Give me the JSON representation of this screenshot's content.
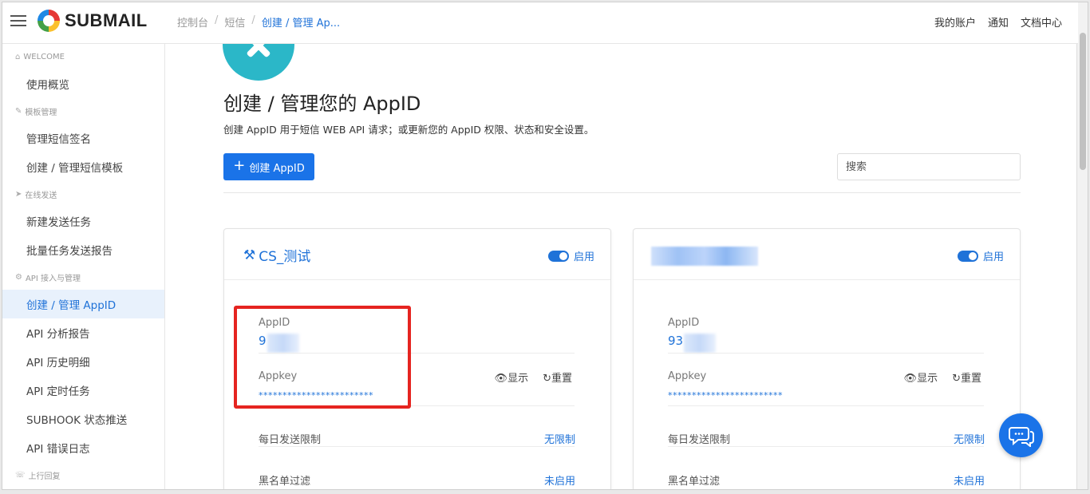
{
  "header": {
    "brand": "SUBMAIL",
    "breadcrumb": [
      "控制台",
      "短信",
      "创建 / 管理 Ap..."
    ],
    "nav": [
      "我的账户",
      "通知",
      "文档中心"
    ]
  },
  "sidebar": {
    "sections": [
      {
        "title": "WELCOME",
        "icon": "home-icon",
        "items": [
          "使用概览"
        ]
      },
      {
        "title": "模板管理",
        "icon": "pencil-icon",
        "items": [
          "管理短信签名",
          "创建 / 管理短信模板"
        ]
      },
      {
        "title": "在线发送",
        "icon": "send-icon",
        "items": [
          "新建发送任务",
          "批量任务发送报告"
        ]
      },
      {
        "title": "API 接入与管理",
        "icon": "api-icon",
        "items": [
          "创建 / 管理 AppID",
          "API 分析报告",
          "API 历史明细",
          "API 定时任务",
          "SUBHOOK 状态推送",
          "API 错误日志"
        ]
      },
      {
        "title": "上行回复",
        "icon": "reply-icon",
        "items": []
      }
    ],
    "active_item": "创建 / 管理 AppID"
  },
  "main": {
    "title": "创建 / 管理您的 AppID",
    "description": "创建 AppID 用于短信 WEB API 请求；或更新您的 AppID 权限、状态和安全设置。",
    "create_button": "创建 AppID",
    "search_placeholder": "搜索"
  },
  "cards": [
    {
      "name": "CS_测试",
      "status": "启用",
      "appid_label": "AppID",
      "appid_value": "9",
      "appkey_label": "Appkey",
      "appkey_value": "************************",
      "show_label": "显示",
      "reset_label": "重置",
      "rows": [
        {
          "label": "每日发送限制",
          "value": "无限制"
        },
        {
          "label": "黑名单过滤",
          "value": "未启用"
        }
      ]
    },
    {
      "name": "",
      "status": "启用",
      "appid_label": "AppID",
      "appid_value": "93",
      "appkey_label": "Appkey",
      "appkey_value": "************************",
      "show_label": "显示",
      "reset_label": "重置",
      "rows": [
        {
          "label": "每日发送限制",
          "value": "无限制"
        },
        {
          "label": "黑名单过滤",
          "value": "未启用"
        }
      ]
    }
  ],
  "colors": {
    "accent": "#1a73e8",
    "highlight": "#e52420",
    "link": "#1f72d8"
  }
}
